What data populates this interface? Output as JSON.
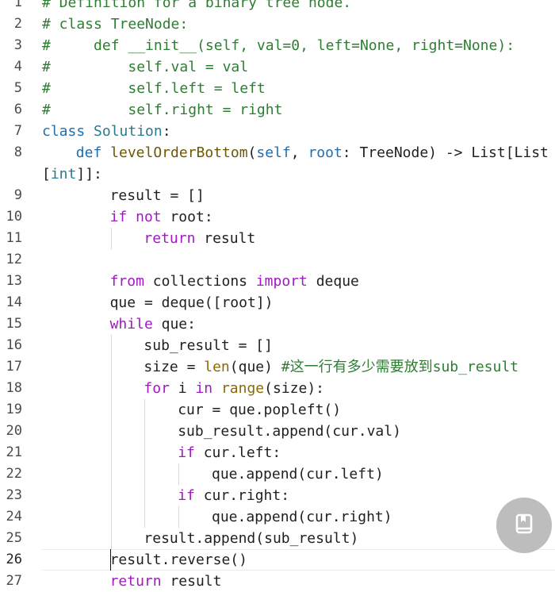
{
  "editor": {
    "current_line": 26,
    "lines": [
      {
        "n": "1",
        "indent": 0,
        "segments": [
          {
            "t": "# Definition for a binary tree node.",
            "k": "c"
          }
        ]
      },
      {
        "n": "2",
        "indent": 0,
        "segments": [
          {
            "t": "# class TreeNode:",
            "k": "c"
          }
        ]
      },
      {
        "n": "3",
        "indent": 0,
        "segments": [
          {
            "t": "#     def __init__(self, val=0, left=None, right=None):",
            "k": "c"
          }
        ]
      },
      {
        "n": "4",
        "indent": 0,
        "segments": [
          {
            "t": "#         self.val = val",
            "k": "c"
          }
        ]
      },
      {
        "n": "5",
        "indent": 0,
        "segments": [
          {
            "t": "#         self.left = left",
            "k": "c"
          }
        ]
      },
      {
        "n": "6",
        "indent": 0,
        "segments": [
          {
            "t": "#         self.right = right",
            "k": "c"
          }
        ]
      },
      {
        "n": "7",
        "indent": 0,
        "segments": [
          {
            "t": "class ",
            "k": "kd"
          },
          {
            "t": "Solution",
            "k": "cl"
          },
          {
            "t": ":",
            "k": ""
          }
        ]
      },
      {
        "n": "8",
        "indent": 1,
        "segments": [
          {
            "t": "def ",
            "k": "kd"
          },
          {
            "t": "levelOrderBottom",
            "k": "fn"
          },
          {
            "t": "(",
            "k": ""
          },
          {
            "t": "self",
            "k": "slf"
          },
          {
            "t": ", ",
            "k": ""
          },
          {
            "t": "root",
            "k": "slf"
          },
          {
            "t": ": TreeNode) -> List[List",
            "k": ""
          }
        ]
      },
      {
        "n": "",
        "indent": 0,
        "segments": [
          {
            "t": "[",
            "k": ""
          },
          {
            "t": "int",
            "k": "t"
          },
          {
            "t": "]]:",
            "k": ""
          }
        ]
      },
      {
        "n": "9",
        "indent": 2,
        "segments": [
          {
            "t": "result = []",
            "k": ""
          }
        ]
      },
      {
        "n": "10",
        "indent": 2,
        "segments": [
          {
            "t": "if ",
            "k": "k"
          },
          {
            "t": "not ",
            "k": "k"
          },
          {
            "t": "root:",
            "k": ""
          }
        ]
      },
      {
        "n": "11",
        "indent": 3,
        "segments": [
          {
            "t": "return ",
            "k": "k"
          },
          {
            "t": "result",
            "k": ""
          }
        ]
      },
      {
        "n": "12",
        "indent": 2,
        "segments": []
      },
      {
        "n": "13",
        "indent": 2,
        "segments": [
          {
            "t": "from ",
            "k": "k"
          },
          {
            "t": "collections ",
            "k": ""
          },
          {
            "t": "import ",
            "k": "k"
          },
          {
            "t": "deque",
            "k": ""
          }
        ]
      },
      {
        "n": "14",
        "indent": 2,
        "segments": [
          {
            "t": "que = deque([root])",
            "k": ""
          }
        ]
      },
      {
        "n": "15",
        "indent": 2,
        "segments": [
          {
            "t": "while ",
            "k": "k"
          },
          {
            "t": "que:",
            "k": ""
          }
        ]
      },
      {
        "n": "16",
        "indent": 3,
        "segments": [
          {
            "t": "sub_result = []",
            "k": ""
          }
        ]
      },
      {
        "n": "17",
        "indent": 3,
        "segments": [
          {
            "t": "size = ",
            "k": ""
          },
          {
            "t": "len",
            "k": "bi"
          },
          {
            "t": "(que) ",
            "k": ""
          },
          {
            "t": "#这一行有多少需要放到sub_result",
            "k": "c"
          }
        ]
      },
      {
        "n": "18",
        "indent": 3,
        "segments": [
          {
            "t": "for ",
            "k": "k"
          },
          {
            "t": "i ",
            "k": ""
          },
          {
            "t": "in ",
            "k": "k"
          },
          {
            "t": "range",
            "k": "bi"
          },
          {
            "t": "(size):",
            "k": ""
          }
        ]
      },
      {
        "n": "19",
        "indent": 4,
        "segments": [
          {
            "t": "cur = que.popleft()",
            "k": ""
          }
        ]
      },
      {
        "n": "20",
        "indent": 4,
        "segments": [
          {
            "t": "sub_result.append(cur.val)",
            "k": ""
          }
        ]
      },
      {
        "n": "21",
        "indent": 4,
        "segments": [
          {
            "t": "if ",
            "k": "k"
          },
          {
            "t": "cur.left:",
            "k": ""
          }
        ]
      },
      {
        "n": "22",
        "indent": 5,
        "segments": [
          {
            "t": "que.append(cur.left)",
            "k": ""
          }
        ]
      },
      {
        "n": "23",
        "indent": 4,
        "segments": [
          {
            "t": "if ",
            "k": "k"
          },
          {
            "t": "cur.right:",
            "k": ""
          }
        ]
      },
      {
        "n": "24",
        "indent": 5,
        "segments": [
          {
            "t": "que.append(cur.right)",
            "k": ""
          }
        ]
      },
      {
        "n": "25",
        "indent": 3,
        "segments": [
          {
            "t": "result.append(sub_result)",
            "k": ""
          }
        ]
      },
      {
        "n": "26",
        "indent": 2,
        "segments": [
          {
            "t": "result.reverse()",
            "k": ""
          }
        ]
      },
      {
        "n": "27",
        "indent": 2,
        "segments": [
          {
            "t": "return ",
            "k": "k"
          },
          {
            "t": "result",
            "k": ""
          }
        ]
      }
    ]
  },
  "fab": {
    "icon": "book-icon"
  }
}
